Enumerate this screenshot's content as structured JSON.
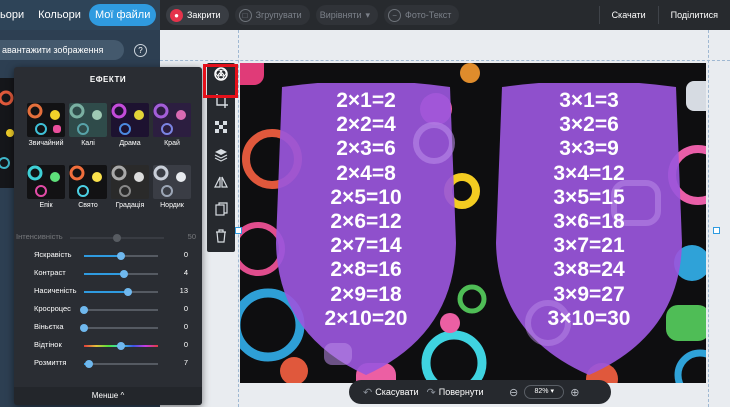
{
  "tabs": [
    "ьори",
    "Кольори",
    "Мої файли"
  ],
  "active_tab": 2,
  "toolbar": {
    "close_label": "Закрити",
    "group_label": "Згрупувати",
    "align_label": "Вирівняти",
    "photo_text_label": "Фото-Текст",
    "download_label": "Скачати",
    "share_label": "Поділитися"
  },
  "upload_label": "авантажити зображення",
  "help_label": "?",
  "effects": {
    "title": "ЕФЕКТИ",
    "filters": [
      "Звичайний",
      "Калі",
      "Драма",
      "Край",
      "Епік",
      "Свято",
      "Градація",
      "Нордик"
    ],
    "intensity": {
      "label": "Інтенсивність",
      "value": "50"
    },
    "sliders": [
      {
        "label": "Яскравість",
        "value": "0",
        "level": 0.5
      },
      {
        "label": "Контраст",
        "value": "4",
        "level": 0.54
      },
      {
        "label": "Насиченість",
        "value": "13",
        "level": 0.6
      },
      {
        "label": "Кросроцес",
        "value": "0",
        "level": 0.0
      },
      {
        "label": "Віньєтка",
        "value": "0",
        "level": 0.0
      },
      {
        "label": "Відтінок",
        "value": "0",
        "level": 0.5
      },
      {
        "label": "Розмиття",
        "value": "7",
        "level": 0.07
      }
    ],
    "less_label": "Менше ^"
  },
  "side_icons": [
    "filter-icon",
    "crop-icon",
    "transparency-icon",
    "layers-icon",
    "flip-icon",
    "copy-icon",
    "trash-icon"
  ],
  "table2": [
    "2×1=2",
    "2×2=4",
    "2×3=6",
    "2×4=8",
    "2×5=10",
    "2×6=12",
    "2×7=14",
    "2×8=16",
    "2×9=18",
    "2×10=20"
  ],
  "table3": [
    "3×1=3",
    "3×2=6",
    "3×3=9",
    "3×4=12",
    "3×5=15",
    "3×6=18",
    "3×7=21",
    "3×8=24",
    "3×9=27",
    "3×10=30"
  ],
  "bottom": {
    "undo_label": "Скасувати",
    "redo_label": "Повернути",
    "zoom_label": "82%"
  },
  "colors": {
    "accent": "#2f9be0",
    "shield": "#9a56dc",
    "highlight": "#e5101a"
  }
}
